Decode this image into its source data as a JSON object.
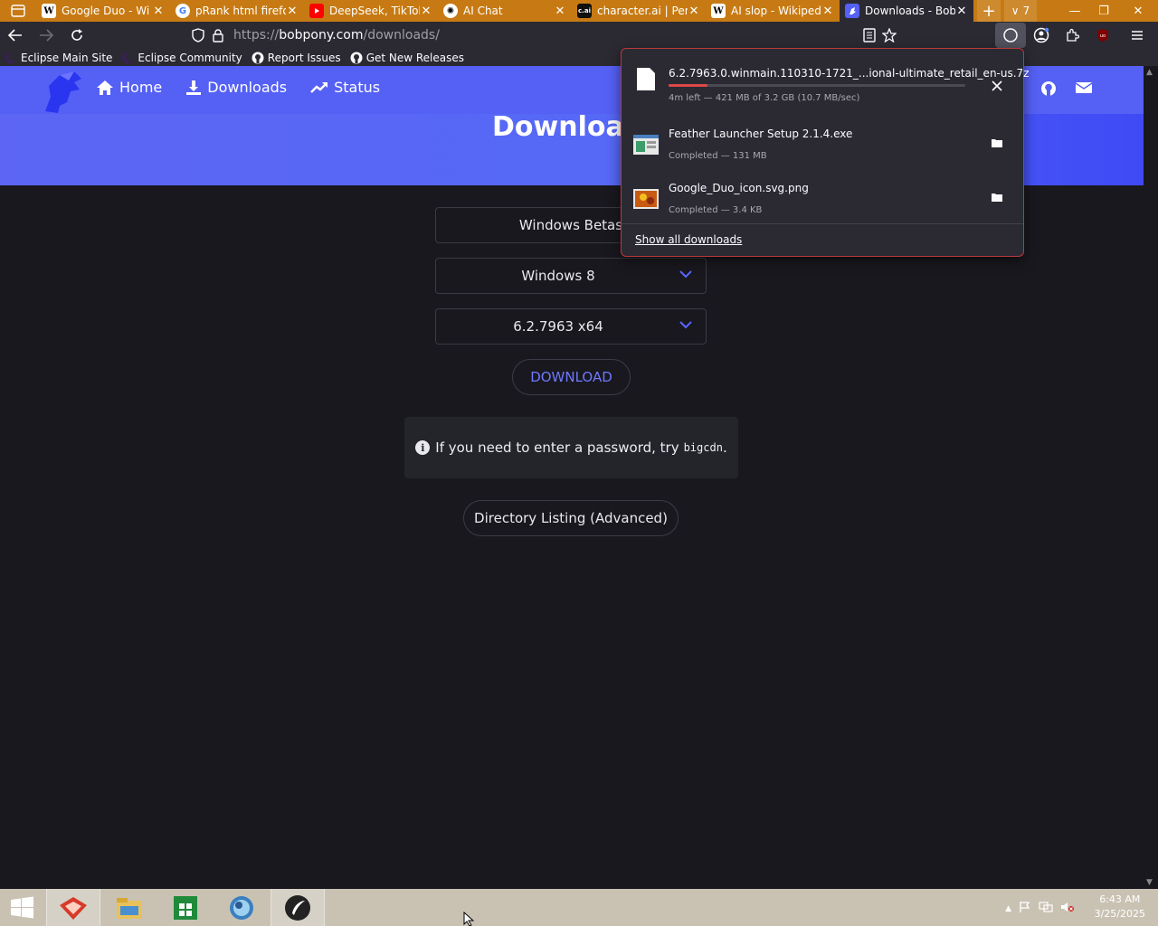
{
  "browser": {
    "tabs": [
      {
        "title": "Google Duo - Wi",
        "favicon": "W",
        "active": false
      },
      {
        "title": "pRank html firefo",
        "favicon": "G",
        "active": false
      },
      {
        "title": "DeepSeek, TikTok",
        "favicon": "yt",
        "active": false
      },
      {
        "title": "AI Chat",
        "favicon": "ai",
        "active": false
      },
      {
        "title": "character.ai | Pers",
        "favicon": "c.ai",
        "active": false
      },
      {
        "title": "AI slop - Wikiped",
        "favicon": "W",
        "active": false
      },
      {
        "title": "Downloads - Bob",
        "favicon": "bob",
        "active": true
      }
    ],
    "new_tab_label": "+",
    "overflow_count": "7",
    "url": {
      "scheme": "https://",
      "host": "bobpony.com",
      "path": "/downloads/"
    },
    "bookmarks": [
      {
        "label": "Eclipse Main Site",
        "icon": "eclipse-icon"
      },
      {
        "label": "Eclipse Community",
        "icon": "eclipse-icon"
      },
      {
        "label": "Report Issues",
        "icon": "github-icon"
      },
      {
        "label": "Get New Releases",
        "icon": "github-icon"
      }
    ]
  },
  "site": {
    "nav": {
      "home": "Home",
      "downloads": "Downloads",
      "status": "Status"
    },
    "hero_title": "Download",
    "form": {
      "category": "Windows Betas",
      "os": "Windows 8",
      "build": "6.2.7963 x64"
    },
    "download_button": "DOWNLOAD",
    "notice_text": "If you need to enter a password, try",
    "notice_code": "bigcdn",
    "notice_end": ".",
    "directory_button": "Directory Listing (Advanced)"
  },
  "downloads_panel": {
    "items": [
      {
        "name": "6.2.7963.0.winmain.110310-1721_...ional-ultimate_retail_en-us.7z",
        "status": "4m left — 421 MB of 3.2 GB (10.7 MB/sec)",
        "progress": 0.13,
        "state": "in-progress"
      },
      {
        "name": "Feather Launcher Setup 2.1.4.exe",
        "status": "Completed — 131 MB",
        "state": "completed"
      },
      {
        "name": "Google_Duo_icon.svg.png",
        "status": "Completed — 3.4 KB",
        "state": "completed"
      }
    ],
    "show_all": "Show all downloads"
  },
  "taskbar": {
    "time": "6:43 AM",
    "date": "3/25/2025"
  },
  "colors": {
    "tabstrip": "#c77a13",
    "accent": "#5560f5",
    "progress": "#e04848",
    "page_bg": "#18181e"
  }
}
